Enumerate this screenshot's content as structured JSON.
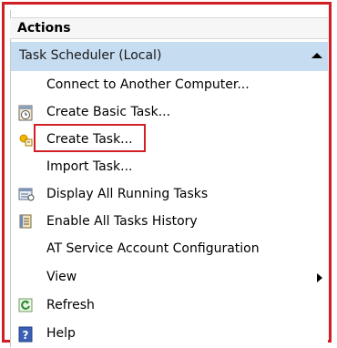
{
  "panel": {
    "title": "Actions",
    "group": {
      "label": "Task Scheduler (Local)",
      "icon": "collapse-up-icon"
    },
    "items": [
      {
        "label": "Connect to Another Computer...",
        "icon": ""
      },
      {
        "label": "Create Basic Task...",
        "icon": "calendar-clock-icon"
      },
      {
        "label": "Create Task...",
        "icon": "task-sun-icon"
      },
      {
        "label": "Import Task...",
        "icon": ""
      },
      {
        "label": "Display All Running Tasks",
        "icon": "running-tasks-icon"
      },
      {
        "label": "Enable All Tasks History",
        "icon": "history-book-icon"
      },
      {
        "label": "AT Service Account Configuration",
        "icon": ""
      },
      {
        "label": "View",
        "icon": "submenu-arrow-icon"
      },
      {
        "label": "Refresh",
        "icon": "refresh-icon"
      },
      {
        "label": "Help",
        "icon": "help-icon"
      }
    ]
  },
  "colors": {
    "highlight_border": "#d11f26",
    "group_bg": "#c6dcf1"
  }
}
